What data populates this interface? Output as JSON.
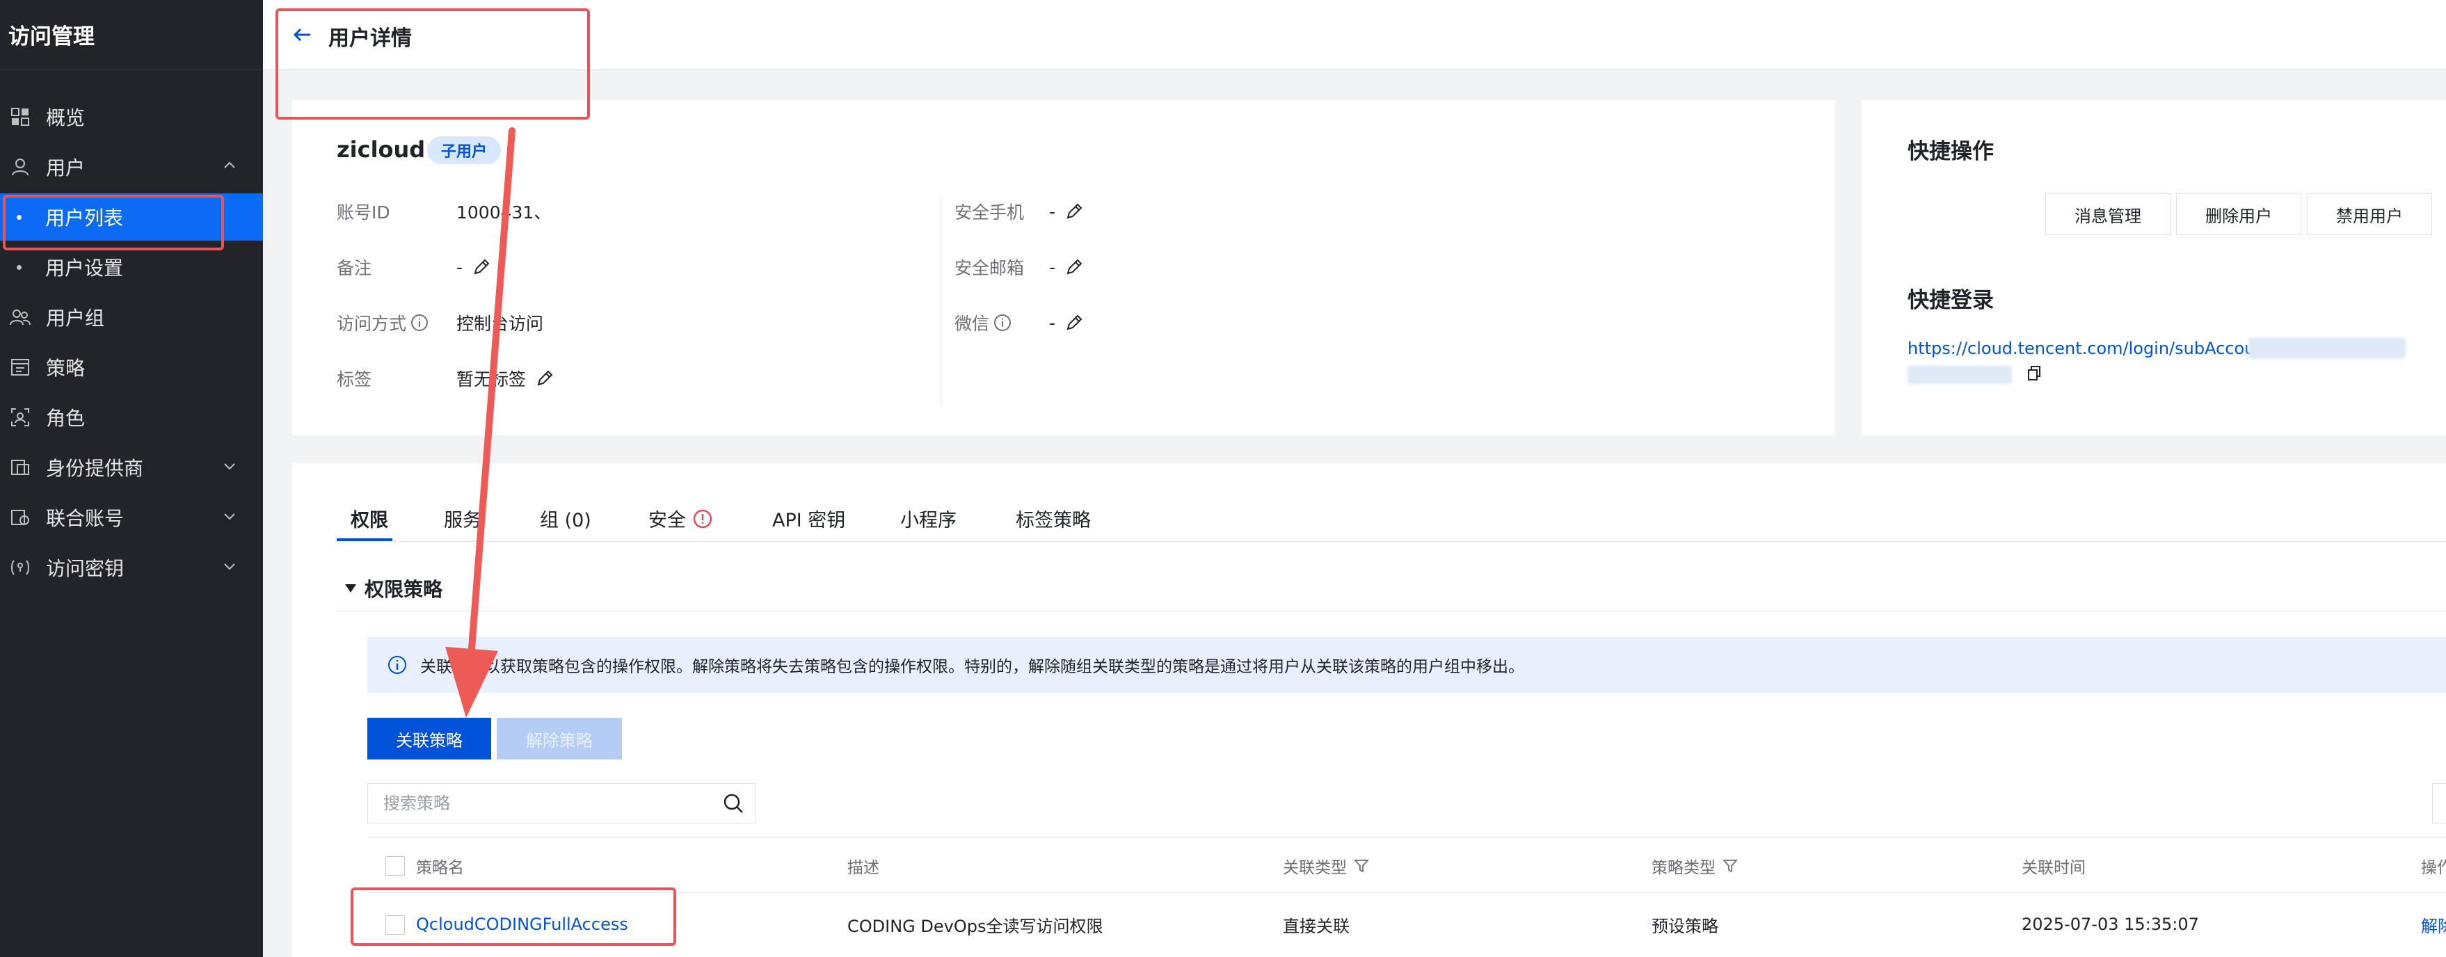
{
  "sidebar": {
    "title": "访问管理",
    "items": [
      {
        "label": "概览",
        "icon": "grid-icon"
      },
      {
        "label": "用户",
        "icon": "user-icon"
      },
      {
        "label": "用户列表"
      },
      {
        "label": "用户设置"
      },
      {
        "label": "用户组",
        "icon": "user-group-icon"
      },
      {
        "label": "策略",
        "icon": "policy-icon"
      },
      {
        "label": "角色",
        "icon": "role-icon"
      },
      {
        "label": "身份提供商",
        "icon": "identity-provider-icon"
      },
      {
        "label": "联合账号",
        "icon": "federated-account-icon"
      },
      {
        "label": "访问密钥",
        "icon": "access-key-icon"
      }
    ]
  },
  "header": {
    "title": "用户详情"
  },
  "user": {
    "name": "zicloud",
    "badge": "子用户",
    "fields": {
      "account_id_label": "账号ID",
      "account_id_value": "1000431、",
      "remark_label": "备注",
      "remark_value": "-",
      "access_label": "访问方式",
      "access_value": "控制台访问",
      "tags_label": "标签",
      "tags_value": "暂无标签",
      "phone_label": "安全手机",
      "phone_value": "-",
      "email_label": "安全邮箱",
      "email_value": "-",
      "wechat_label": "微信",
      "wechat_value": "-"
    }
  },
  "quick_actions": {
    "title": "快捷操作",
    "buttons": [
      "消息管理",
      "删除用户",
      "禁用用户"
    ],
    "login_title": "快捷登录",
    "login_url": "https://cloud.tencent.com/login/subAccount/1"
  },
  "tabs": [
    "权限",
    "服务",
    "组 (0)",
    "安全",
    "API 密钥",
    "小程序",
    "标签策略"
  ],
  "permissions": {
    "section_title": "权限策略",
    "notice": "关联策略以获取策略包含的操作权限。解除策略将失去策略包含的操作权限。特别的，解除随组关联类型的策略是通过将用户从关联该策略的用户组中移出。",
    "attach_button": "关联策略",
    "detach_button": "解除策略",
    "search_placeholder": "搜索策略",
    "columns": [
      "策略名",
      "描述",
      "关联类型",
      "策略类型",
      "关联时间",
      "操作"
    ],
    "rows": [
      {
        "name": "QcloudCODINGFullAccess",
        "description": "CODING DevOps全读写访问权限",
        "association_type": "直接关联",
        "policy_type": "预设策略",
        "time": "2025-07-03 15:35:07",
        "action": "解除"
      }
    ]
  },
  "colors": {
    "sidebar_bg": "#232429",
    "accent": "#0052d9",
    "active_nav": "#0b6bf5",
    "annotation": "#e9535a"
  }
}
